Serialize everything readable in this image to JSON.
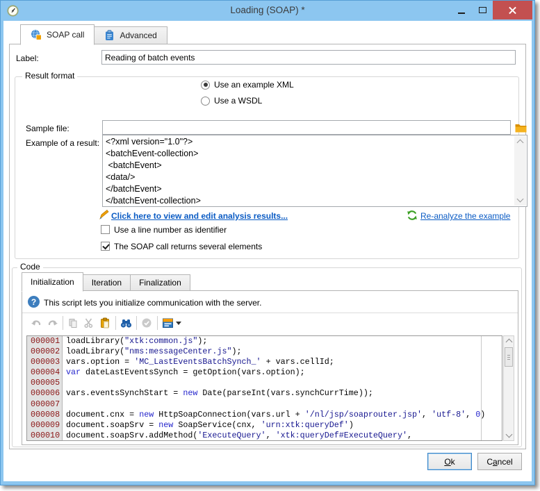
{
  "window": {
    "title": "Loading (SOAP) *"
  },
  "main_tabs": [
    {
      "label": "SOAP call",
      "icon": "globe-icon",
      "active": true
    },
    {
      "label": "Advanced",
      "icon": "clipboard-icon",
      "active": false
    }
  ],
  "form": {
    "label_field": {
      "label": "Label:",
      "value": "Reading of batch events"
    },
    "result_format": {
      "legend": "Result format",
      "radio_example_xml": {
        "label": "Use an example XML",
        "selected": true
      },
      "radio_wsdl": {
        "label": "Use a WSDL",
        "selected": false
      },
      "sample_file": {
        "label": "Sample file:",
        "value": ""
      },
      "example": {
        "label": "Example of a result:",
        "value": "<?xml version=\"1.0\"?>\n<batchEvent-collection>\n <batchEvent>\n<data/>\n</batchEvent>\n</batchEvent-collection>"
      },
      "analysis_link": "Click here to view and edit analysis results...",
      "reanalyze_link": "Re-analyze the example",
      "check_line_number": {
        "label": "Use a line number as identifier",
        "checked": false
      },
      "check_several": {
        "label": "The SOAP call returns several elements",
        "checked": true
      }
    }
  },
  "code": {
    "legend": "Code",
    "tabs": [
      {
        "label": "Initialization",
        "active": true
      },
      {
        "label": "Iteration",
        "active": false
      },
      {
        "label": "Finalization",
        "active": false
      }
    ],
    "info": "This script lets you initialize communication with the server.",
    "toolbar": [
      "undo",
      "redo",
      "copy",
      "cut",
      "paste",
      "find",
      "validate",
      "insert-menu"
    ],
    "editor": {
      "syntax_colors": {
        "keyword": "#2424cc",
        "string": "#16168f",
        "number": "#2424cc",
        "line_number": "#8b1515"
      },
      "lines": [
        {
          "num": "000001",
          "seg": [
            {
              "t": "p",
              "v": "loadLibrary("
            },
            {
              "t": "s",
              "v": "\"xtk:common.js\""
            },
            {
              "t": "p",
              "v": ");"
            }
          ]
        },
        {
          "num": "000002",
          "seg": [
            {
              "t": "p",
              "v": "loadLibrary("
            },
            {
              "t": "s",
              "v": "\"nms:messageCenter.js\""
            },
            {
              "t": "p",
              "v": ");"
            }
          ]
        },
        {
          "num": "000003",
          "seg": [
            {
              "t": "p",
              "v": "vars.option = "
            },
            {
              "t": "s",
              "v": "'MC_LastEventsBatchSynch_'"
            },
            {
              "t": "p",
              "v": " + vars.cellId;"
            }
          ]
        },
        {
          "num": "000004",
          "seg": [
            {
              "t": "k",
              "v": "var"
            },
            {
              "t": "p",
              "v": " dateLastEventsSynch = getOption(vars.option);"
            }
          ]
        },
        {
          "num": "000005",
          "seg": []
        },
        {
          "num": "000006",
          "seg": [
            {
              "t": "p",
              "v": "vars.eventsSynchStart = "
            },
            {
              "t": "k",
              "v": "new"
            },
            {
              "t": "p",
              "v": " Date(parseInt(vars.synchCurrTime));"
            }
          ]
        },
        {
          "num": "000007",
          "seg": []
        },
        {
          "num": "000008",
          "seg": [
            {
              "t": "p",
              "v": "document.cnx = "
            },
            {
              "t": "k",
              "v": "new"
            },
            {
              "t": "p",
              "v": " HttpSoapConnection(vars.url + "
            },
            {
              "t": "s",
              "v": "'/nl/jsp/soaprouter.jsp'"
            },
            {
              "t": "p",
              "v": ", "
            },
            {
              "t": "s",
              "v": "'utf-8'"
            },
            {
              "t": "p",
              "v": ", "
            },
            {
              "t": "n",
              "v": "0"
            },
            {
              "t": "p",
              "v": ")"
            }
          ]
        },
        {
          "num": "000009",
          "seg": [
            {
              "t": "p",
              "v": "document.soapSrv = "
            },
            {
              "t": "k",
              "v": "new"
            },
            {
              "t": "p",
              "v": " SoapService(cnx, "
            },
            {
              "t": "s",
              "v": "'urn:xtk:queryDef'"
            },
            {
              "t": "p",
              "v": ")"
            }
          ]
        },
        {
          "num": "000010",
          "seg": [
            {
              "t": "p",
              "v": "document.soapSrv.addMethod("
            },
            {
              "t": "s",
              "v": "'ExecuteQuery'"
            },
            {
              "t": "p",
              "v": ", "
            },
            {
              "t": "s",
              "v": "'xtk:queryDef#ExecuteQuery'"
            },
            {
              "t": "p",
              "v": ","
            }
          ]
        }
      ]
    }
  },
  "footer": {
    "ok": "Ok",
    "cancel": "Cancel",
    "ok_key": "O",
    "ok_rest": "k",
    "cancel_pre": "C",
    "cancel_key": "a",
    "cancel_rest": "ncel"
  },
  "colors": {
    "titlebar": "#8cc6f0",
    "close_button": "#c35050",
    "link": "#0a5bc4",
    "refresh_green": "#3ba023",
    "folder_orange": "#f0a800"
  },
  "icons": {
    "question_glyph": "?"
  }
}
